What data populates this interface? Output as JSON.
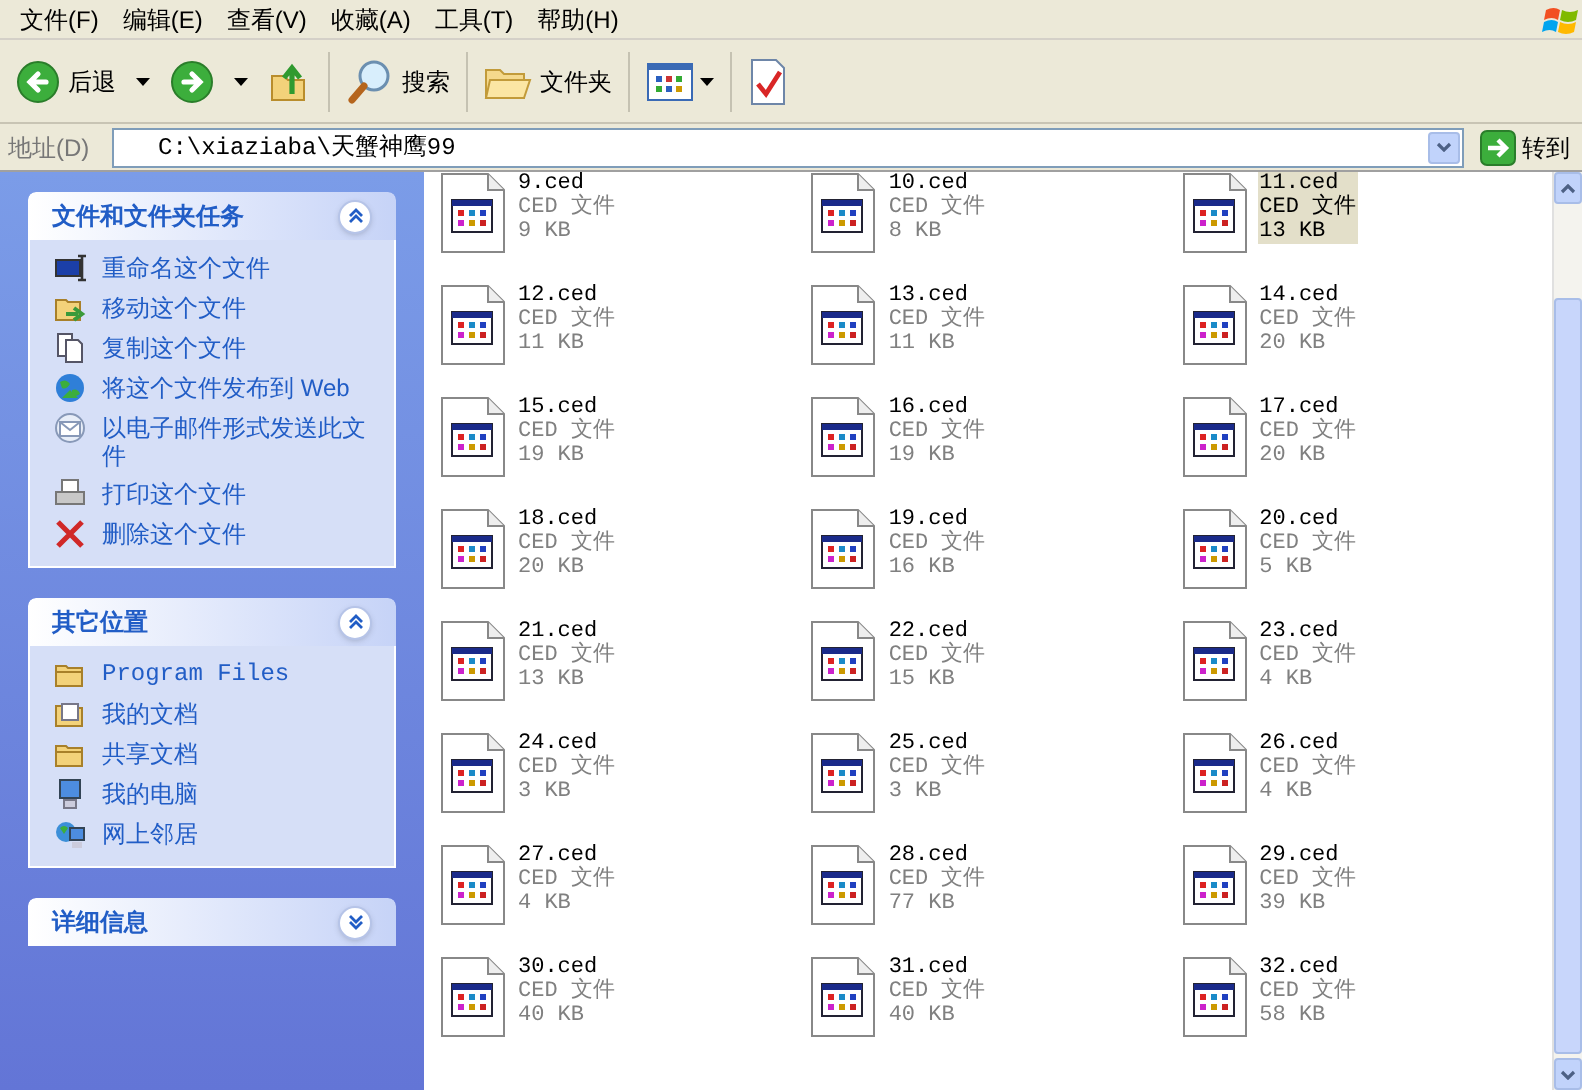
{
  "menu_bar": [
    "文件(F)",
    "编辑(E)",
    "查看(V)",
    "收藏(A)",
    "工具(T)",
    "帮助(H)"
  ],
  "toolbar": {
    "back": "后退",
    "search": "搜索",
    "folders": "文件夹"
  },
  "address_bar": {
    "label": "地址(D)",
    "value": "C:\\xiaziaba\\天蟹神鹰99",
    "go": "转到"
  },
  "sidebar": {
    "panels": [
      {
        "title": "文件和文件夹任务",
        "expanded": true,
        "items": [
          {
            "kind": "rename",
            "label": "重命名这个文件"
          },
          {
            "kind": "move",
            "label": "移动这个文件"
          },
          {
            "kind": "copy",
            "label": "复制这个文件"
          },
          {
            "kind": "web",
            "label": "将这个文件发布到 Web"
          },
          {
            "kind": "email",
            "label": "以电子邮件形式发送此文件"
          },
          {
            "kind": "print",
            "label": "打印这个文件"
          },
          {
            "kind": "delete",
            "label": "删除这个文件"
          }
        ]
      },
      {
        "title": "其它位置",
        "expanded": true,
        "items": [
          {
            "kind": "folder",
            "label": "Program Files"
          },
          {
            "kind": "docs",
            "label": "我的文档"
          },
          {
            "kind": "folder",
            "label": "共享文档"
          },
          {
            "kind": "computer",
            "label": "我的电脑"
          },
          {
            "kind": "network",
            "label": "网上邻居"
          }
        ]
      },
      {
        "title": "详细信息",
        "expanded": false
      }
    ]
  },
  "files": [
    {
      "name": "9.ced",
      "type": "CED 文件",
      "size": "9 KB",
      "selected": false
    },
    {
      "name": "10.ced",
      "type": "CED 文件",
      "size": "8 KB",
      "selected": false
    },
    {
      "name": "11.ced",
      "type": "CED 文件",
      "size": "13 KB",
      "selected": true
    },
    {
      "name": "12.ced",
      "type": "CED 文件",
      "size": "11 KB",
      "selected": false
    },
    {
      "name": "13.ced",
      "type": "CED 文件",
      "size": "11 KB",
      "selected": false
    },
    {
      "name": "14.ced",
      "type": "CED 文件",
      "size": "20 KB",
      "selected": false
    },
    {
      "name": "15.ced",
      "type": "CED 文件",
      "size": "19 KB",
      "selected": false
    },
    {
      "name": "16.ced",
      "type": "CED 文件",
      "size": "19 KB",
      "selected": false
    },
    {
      "name": "17.ced",
      "type": "CED 文件",
      "size": "20 KB",
      "selected": false
    },
    {
      "name": "18.ced",
      "type": "CED 文件",
      "size": "20 KB",
      "selected": false
    },
    {
      "name": "19.ced",
      "type": "CED 文件",
      "size": "16 KB",
      "selected": false
    },
    {
      "name": "20.ced",
      "type": "CED 文件",
      "size": "5 KB",
      "selected": false
    },
    {
      "name": "21.ced",
      "type": "CED 文件",
      "size": "13 KB",
      "selected": false
    },
    {
      "name": "22.ced",
      "type": "CED 文件",
      "size": "15 KB",
      "selected": false
    },
    {
      "name": "23.ced",
      "type": "CED 文件",
      "size": "4 KB",
      "selected": false
    },
    {
      "name": "24.ced",
      "type": "CED 文件",
      "size": "3 KB",
      "selected": false
    },
    {
      "name": "25.ced",
      "type": "CED 文件",
      "size": "3 KB",
      "selected": false
    },
    {
      "name": "26.ced",
      "type": "CED 文件",
      "size": "4 KB",
      "selected": false
    },
    {
      "name": "27.ced",
      "type": "CED 文件",
      "size": "4 KB",
      "selected": false
    },
    {
      "name": "28.ced",
      "type": "CED 文件",
      "size": "77 KB",
      "selected": false
    },
    {
      "name": "29.ced",
      "type": "CED 文件",
      "size": "39 KB",
      "selected": false
    },
    {
      "name": "30.ced",
      "type": "CED 文件",
      "size": "40 KB",
      "selected": false
    },
    {
      "name": "31.ced",
      "type": "CED 文件",
      "size": "40 KB",
      "selected": false
    },
    {
      "name": "32.ced",
      "type": "CED 文件",
      "size": "58 KB",
      "selected": false
    }
  ]
}
